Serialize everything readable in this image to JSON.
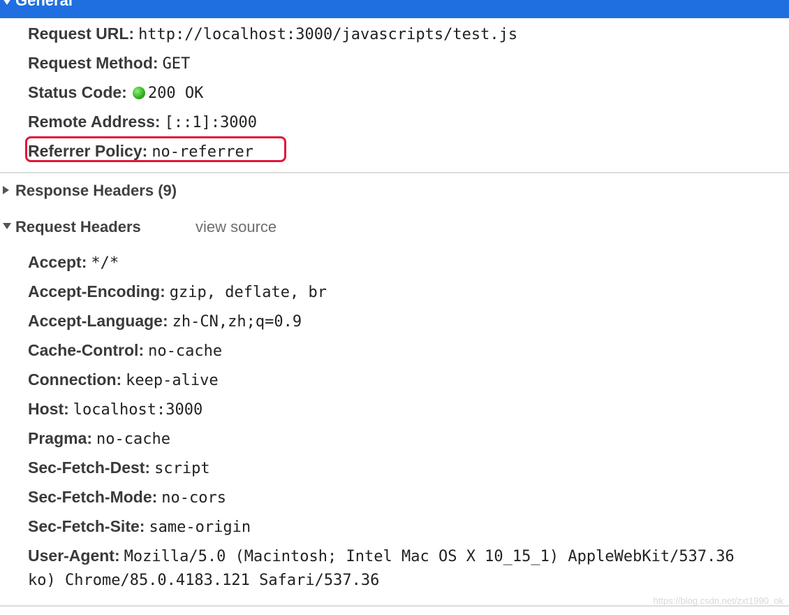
{
  "general": {
    "title": "General"
  },
  "general_rows": [
    {
      "key": "Request URL:",
      "value": "http://localhost:3000/javascripts/test.js"
    },
    {
      "key": "Request Method:",
      "value": "GET"
    },
    {
      "key": "Status Code:",
      "value": "200 OK",
      "status_color": "#2fae1c"
    },
    {
      "key": "Remote Address:",
      "value": "[::1]:3000"
    },
    {
      "key": "Referrer Policy:",
      "value": "no-referrer",
      "highlight_color": "#e0173a"
    }
  ],
  "response_headers": {
    "label": "Response Headers (9)"
  },
  "request_headers": {
    "label": "Request Headers",
    "view_source": "view source"
  },
  "request_rows": [
    {
      "key": "Accept:",
      "value": "*/*"
    },
    {
      "key": "Accept-Encoding:",
      "value": "gzip, deflate, br"
    },
    {
      "key": "Accept-Language:",
      "value": "zh-CN,zh;q=0.9"
    },
    {
      "key": "Cache-Control:",
      "value": "no-cache"
    },
    {
      "key": "Connection:",
      "value": "keep-alive"
    },
    {
      "key": "Host:",
      "value": "localhost:3000"
    },
    {
      "key": "Pragma:",
      "value": "no-cache"
    },
    {
      "key": "Sec-Fetch-Dest:",
      "value": "script"
    },
    {
      "key": "Sec-Fetch-Mode:",
      "value": "no-cors"
    },
    {
      "key": "Sec-Fetch-Site:",
      "value": "same-origin"
    },
    {
      "key": "User-Agent:",
      "value": "Mozilla/5.0 (Macintosh; Intel Mac OS X 10_15_1) AppleWebKit/537.36"
    }
  ],
  "user_agent_wrap": "ko) Chrome/85.0.4183.121 Safari/537.36",
  "watermark": "https://blog.csdn.net/zxt1990_ok",
  "colors": {
    "accent": "#1f6fe0"
  }
}
